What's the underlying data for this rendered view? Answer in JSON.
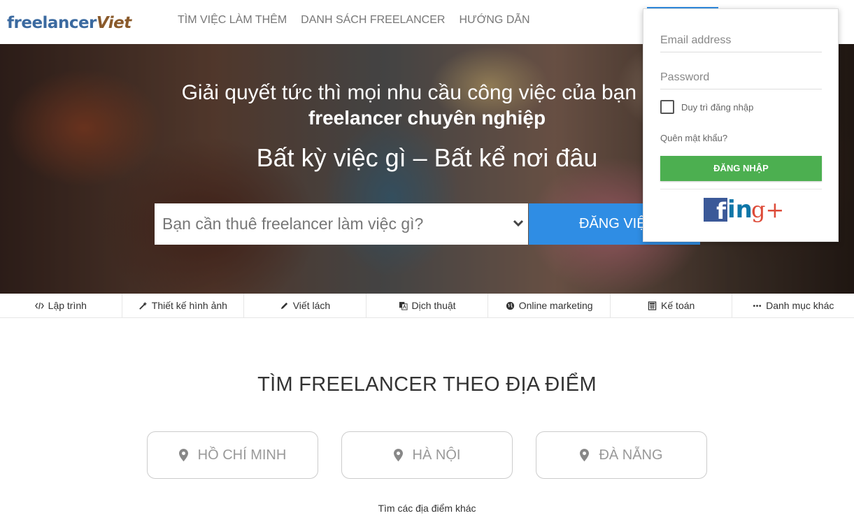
{
  "header": {
    "logo": {
      "part1": "freelancer",
      "part2": "Viet"
    },
    "nav": [
      {
        "label": "TÌM VIỆC LÀM THÊM"
      },
      {
        "label": "DANH SÁCH FREELANCER"
      },
      {
        "label": "HƯỚNG DẪN"
      }
    ]
  },
  "hero": {
    "title_line1": "Giải quyết tức thì mọi nhu cầu công việc của bạn bởi",
    "title_line2": "freelancer chuyên nghiệp",
    "subtitle": "Bất kỳ việc gì – Bất kể nơi đâu",
    "search": {
      "placeholder": "Bạn cần thuê freelancer làm việc gì?",
      "value": ""
    },
    "post_button": "ĐĂNG VIỆC"
  },
  "categories": [
    {
      "label": "Lập trình",
      "icon": "code-icon"
    },
    {
      "label": "Thiết kế hình ảnh",
      "icon": "magic-wand-icon"
    },
    {
      "label": "Viết lách",
      "icon": "pencil-icon"
    },
    {
      "label": "Dịch thuật",
      "icon": "translate-icon"
    },
    {
      "label": "Online marketing",
      "icon": "globe-icon"
    },
    {
      "label": "Kế toán",
      "icon": "calculator-icon"
    },
    {
      "label": "Danh mục khác",
      "icon": "more-icon"
    }
  ],
  "locations": {
    "title": "TÌM FREELANCER THEO ĐỊA ĐIỂM",
    "items": [
      {
        "label": "HỒ CHÍ MINH"
      },
      {
        "label": "HÀ NỘI"
      },
      {
        "label": "ĐÀ NẴNG"
      }
    ],
    "more": "Tìm các địa điểm khác"
  },
  "login": {
    "email": {
      "placeholder": "Email address",
      "value": ""
    },
    "password": {
      "placeholder": "Password",
      "value": ""
    },
    "remember_label": "Duy trì đăng nhập",
    "forgot": "Quên mật khẩu?",
    "button": "ĐĂNG NHẬP",
    "social": {
      "facebook": "f",
      "linkedin": "in",
      "google": "g+"
    }
  },
  "colors": {
    "accent_blue": "#2f8de4",
    "login_green": "#4caf50",
    "facebook": "#3b5998",
    "linkedin": "#0e76a8",
    "google": "#dd4b39"
  }
}
